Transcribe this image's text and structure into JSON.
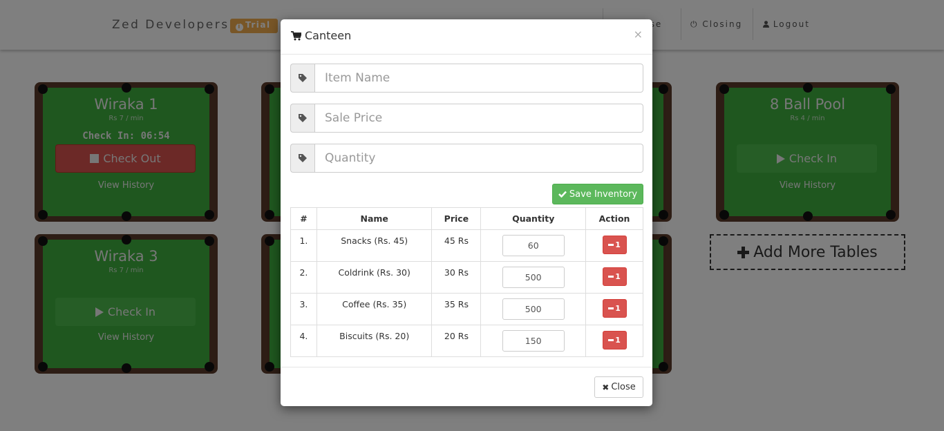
{
  "navbar": {
    "brand": "Zed Developers",
    "trial_badge": "Trial",
    "items": [
      {
        "label": "nse"
      },
      {
        "label": "Closing"
      },
      {
        "label": "Logout"
      }
    ]
  },
  "tables": [
    {
      "name": "Wiraka 1",
      "rate": "Rs 7 / min",
      "check_in_time": "Check In: 06:54",
      "button": "Check Out",
      "history": "View History"
    },
    {
      "name": "8 Ball Pool",
      "rate": "Rs 4 / min",
      "button": "Check In",
      "history": "View History"
    },
    {
      "name": "Wiraka 3",
      "rate": "Rs 7 / min",
      "button": "Check In",
      "history": "View History"
    }
  ],
  "add_more_label": "Add More Tables",
  "modal": {
    "title": "Canteen",
    "close_x": "×",
    "item_name_placeholder": "Item Name",
    "sale_price_placeholder": "Sale Price",
    "quantity_placeholder": "Quantity",
    "save_label": "Save Inventory",
    "columns": [
      "#",
      "Name",
      "Price",
      "Quantity",
      "Action"
    ],
    "rows": [
      {
        "num": "1.",
        "name": "Snacks (Rs. 45)",
        "price": "45 Rs",
        "qty": "60",
        "action": "1"
      },
      {
        "num": "2.",
        "name": "Coldrink (Rs. 30)",
        "price": "30 Rs",
        "qty": "500",
        "action": "1"
      },
      {
        "num": "3.",
        "name": "Coffee (Rs. 35)",
        "price": "35 Rs",
        "qty": "500",
        "action": "1"
      },
      {
        "num": "4.",
        "name": "Biscuits (Rs. 20)",
        "price": "20 Rs",
        "qty": "150",
        "action": "1"
      }
    ],
    "close_label": "Close"
  },
  "colors": {
    "felt": "#3fae3f",
    "rail": "#5b3a2a",
    "success": "#5cb85c",
    "danger": "#d9534f",
    "warning": "#f0ad4e"
  }
}
